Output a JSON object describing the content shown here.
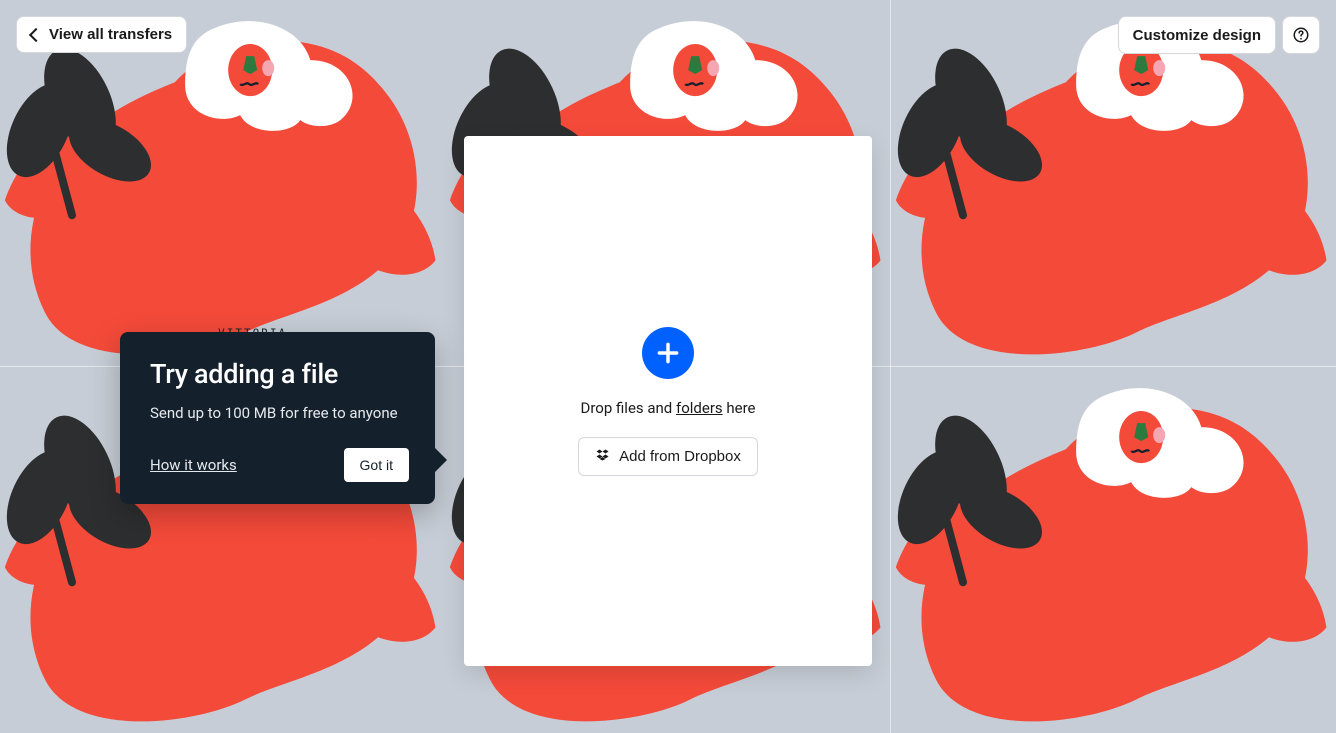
{
  "colors": {
    "accent_blue": "#0061ff",
    "coach_bg": "#14202c",
    "bg_red": "#f44a3a",
    "bg_gray": "#c7cdd6",
    "bg_dark": "#2d2e2f"
  },
  "top_left": {
    "view_all_label": "View all transfers"
  },
  "top_right": {
    "customize_label": "Customize design"
  },
  "card": {
    "drop_text_pre": "Drop files and ",
    "drop_text_folders": "folders",
    "drop_text_post": " here",
    "add_from_dropbox_label": "Add from Dropbox"
  },
  "coach": {
    "title": "Try adding a file",
    "body": "Send up to 100 MB for free to anyone",
    "how_it_works_label": "How it works",
    "got_it_label": "Got it"
  },
  "background": {
    "signature": "VITTORIA"
  }
}
